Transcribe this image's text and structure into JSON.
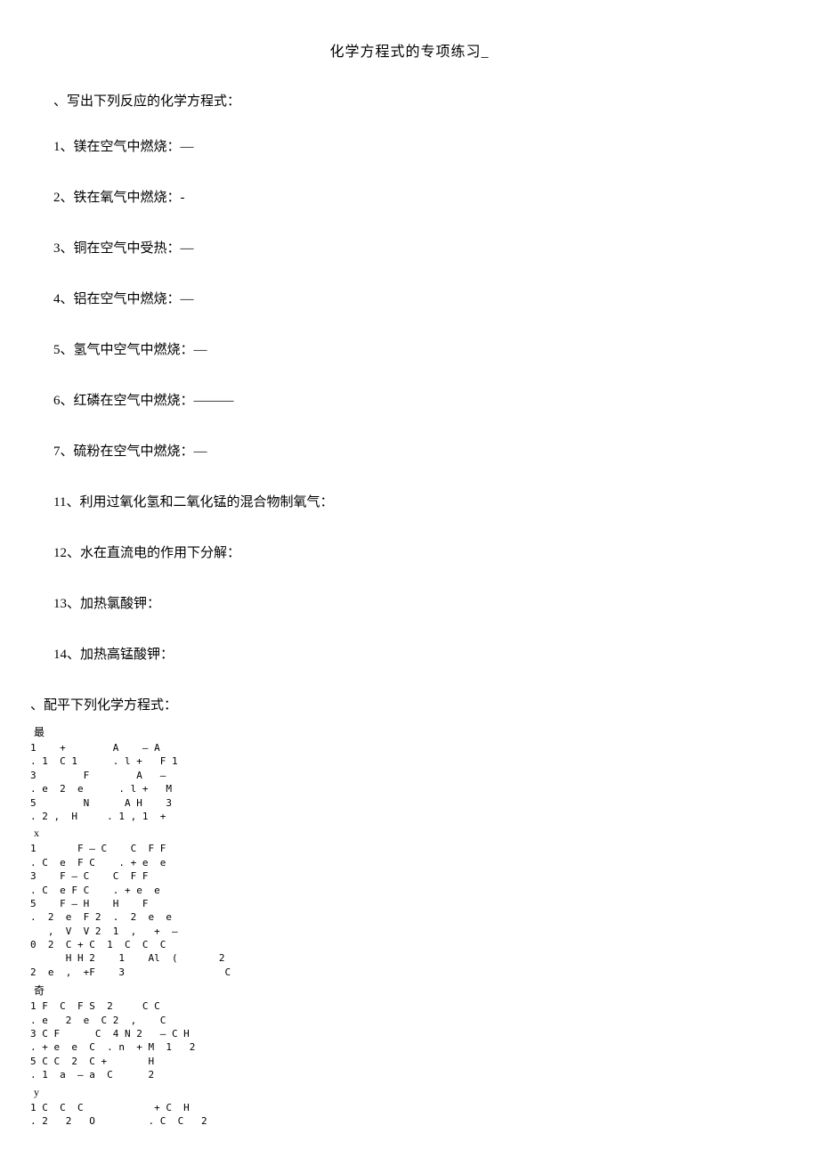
{
  "title": "化学方程式的专项练习_",
  "section1": "、写出下列反应的化学方程式：",
  "q1": "1、镁在空气中燃烧：—",
  "q2": "2、铁在氧气中燃烧：-",
  "q3": "3、铜在空气中受热：—",
  "q4": "4、铝在空气中燃烧：—",
  "q5": "5、氢气中空气中燃烧：—",
  "q6": "6、红磷在空气中燃烧：———",
  "q7": "7、硫粉在空气中燃烧：—",
  "q11": "11、利用过氧化氢和二氧化锰的混合物制氧气：",
  "q12": "12、水在直流电的作用下分解：",
  "q13": "13、加热氯酸钾：",
  "q14": "14、加热高锰酸钾：",
  "section2": "、配平下列化学方程式：",
  "sub_zui": "最",
  "block1_l1": "1    +        A    – A",
  "block1_l2": ". 1  C 1      . l +   F 1",
  "block1_l3": "3        F        A   —",
  "block1_l4": ". e  2  e      . l +   M",
  "block1_l5": "5        N      A H    3",
  "block1_l6": ". 2 ,  H     . 1 , 1  +",
  "sub_x": "x",
  "block2_l1": "1       F – C    C  F F",
  "block2_l2": ". C  e  F C    . + e  e",
  "block2_l3": "3    F – C    C  F F",
  "block2_l4": ". C  e F C    . + e  e",
  "block2_l5": "5    F – H    H    F",
  "block2_l6": ".  2  e  F 2  .  2  e  e",
  "block2_l7": "   ,  V  V 2  1  ,   +  –",
  "block2_l8": "0  2  C + C  1  C  C  C",
  "block2_l9": "      H H 2    1    Al  (       2",
  "block2_l10": "2  e  ,  +F    3                 C",
  "sub_qi": "奇",
  "block3_l1": "1 F  C  F S  2     C C",
  "block3_l2": ". e   2  e  C 2  ,    C",
  "block3_l3": "3 C F      C  4 N 2   – C H",
  "block3_l4": ". + e  e  C  . n  + M  1   2",
  "block3_l5": "5 C C  2  C +       H",
  "block3_l6": ". 1  a  – a  C      2",
  "sub_xi": "y",
  "block4_l1": "1 C  C  C            + C  H",
  "block4_l2": ". 2   2   O         . C  C   2"
}
